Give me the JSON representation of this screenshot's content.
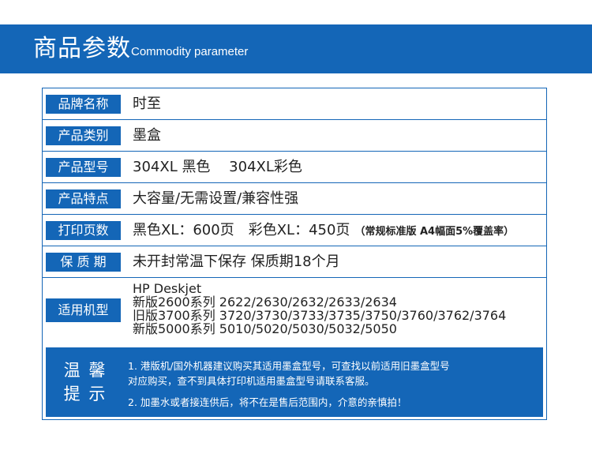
{
  "header": {
    "title": "商品参数",
    "subtitle": "Commodity parameter"
  },
  "params": {
    "brand": {
      "label": "品牌名称",
      "value": "时至"
    },
    "category": {
      "label": "产品类别",
      "value": "墨盒"
    },
    "model": {
      "label": "产品型号",
      "value": "304XL 黑色　 304XL彩色"
    },
    "features": {
      "label": "产品特点",
      "value": "大容量/无需设置/兼容性强"
    },
    "pages": {
      "label": "打印页数",
      "value": "黑色XL：600页　彩色XL：450页",
      "note": "（常规标准版 A4幅面5%覆盖率）"
    },
    "shelf_life": {
      "label": "保 质 期",
      "value": "未开封常温下保存  保质期18个月"
    },
    "models": {
      "label": "适用机型",
      "lines": [
        "HP Deskjet",
        "新版2600系列 2622/2630/2632/2633/2634",
        "旧版3700系列 3720/3730/3733/3735/3750/3760/3762/3764",
        "新版5000系列 5010/5020/5030/5032/5050"
      ]
    }
  },
  "notice": {
    "title_line1": "温 馨",
    "title_line2": "提 示",
    "item1_line1": "1. 港版机/国外机器建议购买其适用墨盒型号，可查找以前适用旧墨盒型号",
    "item1_line2": "对应购买，查不到具体打印机适用墨盒型号请联系客服。",
    "item2": "2. 加墨水或者接连供后，将不在是售后范围内，介意的亲慎拍！"
  }
}
